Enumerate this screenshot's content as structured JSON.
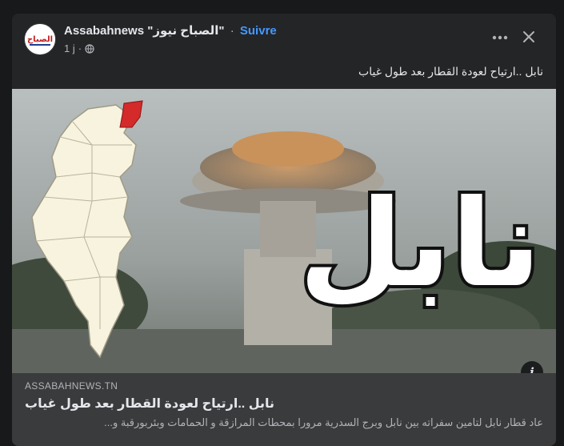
{
  "post": {
    "page_name": "Assabahnews \"الصباح نيوز\"",
    "separator": "·",
    "follow_label": "Suivre",
    "timestamp": "1 j",
    "separator_small": "·",
    "privacy_icon": "globe-icon",
    "more_icon": "more-horizontal-icon",
    "close_icon": "close-icon",
    "text": "نابل ..ارتياح لعودة القطار بعد طول غياب",
    "avatar_text": "الصباح"
  },
  "link_preview": {
    "image_text": "نابل",
    "domain": "ASSABAHNEWS.TN",
    "title": "نابل ..ارتياح لعودة القطار بعد طول غياب",
    "description": "عاد قطار نابل لتامين سفراته بين نابل وبرج السدرية مرورا بمحطات المرازقة و الحمامات وبئربورقبة و...",
    "info_icon": "info-icon",
    "info_label": "i"
  },
  "colors": {
    "background": "#18191a",
    "card": "#242526",
    "link_meta_bg": "#3a3b3c",
    "accent": "#4599ff",
    "map_highlight": "#d42a2a"
  }
}
